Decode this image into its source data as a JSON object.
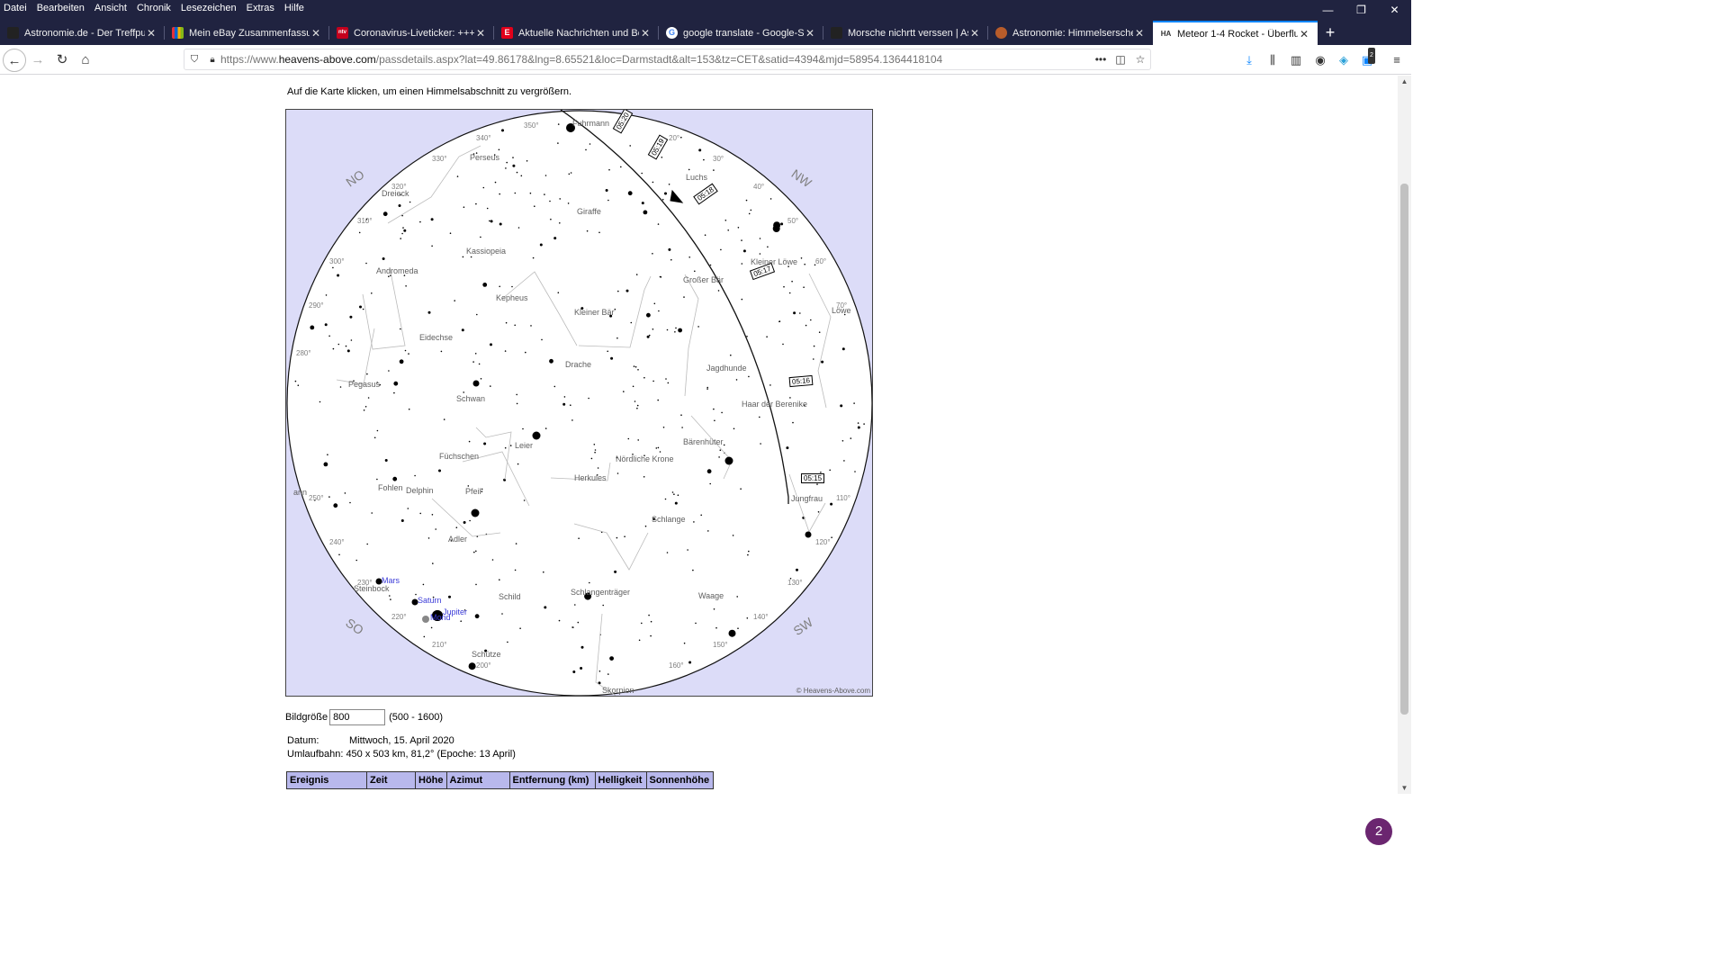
{
  "browser": {
    "menu": [
      "Datei",
      "Bearbeiten",
      "Ansicht",
      "Chronik",
      "Lesezeichen",
      "Extras",
      "Hilfe"
    ],
    "tabs": [
      {
        "title": "Astronomie.de - Der Treffpunkt",
        "favicon_color": "#222222",
        "favicon_text": ""
      },
      {
        "title": "Mein eBay Zusammenfassung",
        "favicon_color": "#e53238",
        "favicon_text": ""
      },
      {
        "title": "Coronavirus-Liveticker: +++ 11",
        "favicon_color": "#c4001d",
        "favicon_text": "ntv"
      },
      {
        "title": "Aktuelle Nachrichten und Beric",
        "favicon_color": "#e2001a",
        "favicon_text": "E"
      },
      {
        "title": "google translate - Google-Such",
        "favicon_color": "#ffffff",
        "favicon_text": "G"
      },
      {
        "title": "Morsche nichrtt verssen | Astro",
        "favicon_color": "#222222",
        "favicon_text": ""
      },
      {
        "title": "Astronomie: Himmelserschein",
        "favicon_color": "#b85c2a",
        "favicon_text": ""
      },
      {
        "title": "Meteor 1-4 Rocket - Überflugd",
        "favicon_color": "#ffffff",
        "favicon_text": "HA"
      }
    ],
    "url_prefix": "https://www.",
    "url_domain": "heavens-above.com",
    "url_path": "/passdetails.aspx?lat=49.86178&lng=8.65521&loc=Darmstadt&alt=153&tz=CET&satid=4394&mjd=58954.1364418104",
    "badge_count": "2"
  },
  "page": {
    "instruction": "Auf die Karte klicken, um einen Himmelsabschnitt zu vergrößern.",
    "copyright": "© Heavens-Above.com",
    "size_label": "Bildgröße",
    "size_value": "800",
    "size_range": "(500 - 1600)",
    "date_label": "Datum:",
    "date_value": "Mittwoch, 15. April 2020",
    "orbit_label": "Umlaufbahn:",
    "orbit_value": "450 x 503 km, 81,2° (Epoche: 13 April)",
    "table_headers": [
      "Ereignis",
      "Zeit",
      "Höhe",
      "Azimut",
      "Entfernung (km)",
      "Helligkeit",
      "Sonnenhöhe"
    ],
    "chat_badge": "2"
  },
  "skymap": {
    "directions": [
      "NO",
      "NW",
      "SO",
      "SW"
    ],
    "azimuth_ticks": [
      "20°",
      "30°",
      "40°",
      "50°",
      "60°",
      "70°",
      "110°",
      "120°",
      "130°",
      "140°",
      "150°",
      "160°",
      "200°",
      "210°",
      "220°",
      "230°",
      "240°",
      "250°",
      "280°",
      "290°",
      "300°",
      "310°",
      "320°",
      "330°",
      "340°",
      "350°"
    ],
    "constellations": [
      "Fuhrmann",
      "Perseus",
      "Dreieck",
      "Giraffe",
      "Luchs",
      "Kassiopeia",
      "Andromeda",
      "Kleiner Löwe",
      "Großer Bär",
      "Kepheus",
      "Kleiner Bär",
      "Löwe",
      "Eidechse",
      "Drache",
      "Jagdhunde",
      "Pegasus",
      "Schwan",
      "Haar der Berenike",
      "Leier",
      "Bärenhüter",
      "Füchschen",
      "Nördliche Krone",
      "Herkules",
      "Fohlen",
      "Delphin",
      "Pfeil",
      "Jungfrau",
      "Schlange",
      "Adler",
      "Steinbock",
      "Schild",
      "Schlangenträger",
      "Waage",
      "Schütze",
      "Skorpion",
      "ann"
    ],
    "planets": [
      "Mars",
      "Saturn",
      "Jupiter",
      "Mond"
    ],
    "pass_times": [
      "05:20",
      "05:19",
      "05:18",
      "05:17",
      "05:16",
      "05:15"
    ]
  }
}
